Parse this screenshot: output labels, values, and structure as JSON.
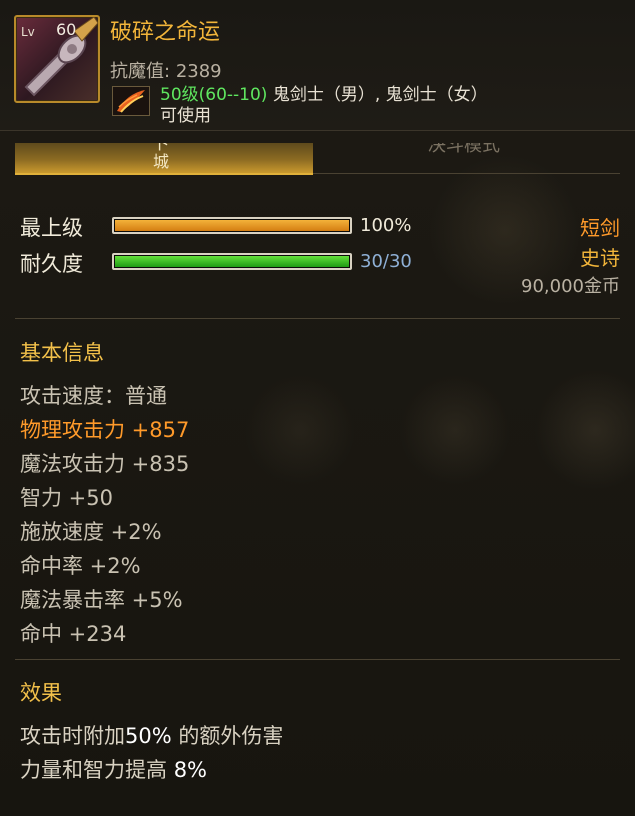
{
  "item": {
    "level_prefix": "Lv",
    "level": "60",
    "name": "破碎之命运",
    "anti_magic_label": "抗魔值:",
    "anti_magic_value": "2389",
    "req_level": "50级(60--10)",
    "req_classes": "鬼剑士（男）, 鬼剑士（女）",
    "usable": "可使用",
    "icon": "sword-hilt-icon",
    "class_icon": "phoenix-feather-icon"
  },
  "tabs": {
    "active_label": "卜城",
    "inactive_label": "决斗模式"
  },
  "bars": {
    "upgrade_label": "最上级",
    "upgrade_value": "100%",
    "upgrade_percent": 100,
    "durability_label": "耐久度",
    "durability_value": "30/30",
    "durability_percent": 100
  },
  "info": {
    "type": "短剑",
    "rarity": "史诗",
    "price": "90,000金币"
  },
  "basic": {
    "title": "基本信息",
    "lines": [
      "攻击速度：普通",
      "物理攻击力 +857",
      "魔法攻击力 +835",
      "智力 +50",
      "施放速度 +2%",
      "命中率 +2%",
      "魔法暴击率 +5%",
      "命中 +234"
    ]
  },
  "effects": {
    "title": "效果",
    "line1_prefix": "攻击时附加",
    "line1_num": "50%",
    "line1_suffix": " 的额外伤害",
    "line2_prefix": "力量和智力提高 ",
    "line2_num": "8%"
  },
  "colors": {
    "gold": "#f2b53a",
    "orange": "#ff9a2a",
    "green": "#5fe65f",
    "durability_text": "#8fb0d6"
  }
}
